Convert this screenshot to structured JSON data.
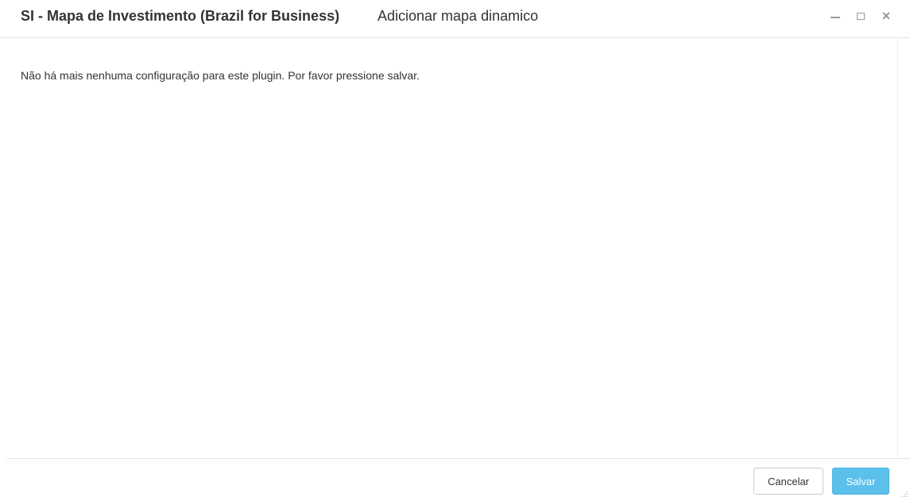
{
  "window": {
    "title": "SI - Mapa de Investimento (Brazil for Business)",
    "subtitle": "Adicionar mapa dinamico",
    "controls": {
      "minimize_icon": "minimize-icon",
      "maximize_icon": "maximize-icon",
      "close_icon": "close-icon",
      "close_glyph": "×"
    }
  },
  "body": {
    "message": "Não há mais nenhuma configuração para este plugin. Por favor pressione salvar."
  },
  "footer": {
    "cancel_label": "Cancelar",
    "save_label": "Salvar"
  },
  "colors": {
    "accent": "#5bc0ea",
    "text": "#333333",
    "border": "#e3e3e3",
    "icon": "#9a9a9a"
  }
}
